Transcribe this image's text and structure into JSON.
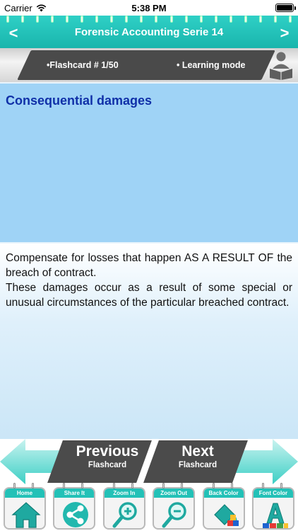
{
  "status": {
    "carrier": "Carrier",
    "time": "5:38 PM"
  },
  "nav": {
    "title": "Forensic Accounting Serie 14",
    "back": "<",
    "forward": ">"
  },
  "info": {
    "flashcard": "•Flashcard #  1/50",
    "mode": "• Learning mode"
  },
  "card": {
    "question": "Consequential damages",
    "answer": "Compensate for losses that happen AS A RESULT OF the breach of contract.\nThese damages occur as a result of some special or unusual circumstances of the particular breached contract."
  },
  "buttons": {
    "previous": {
      "big": "Previous",
      "small": "Flashcard"
    },
    "next": {
      "big": "Next",
      "small": "Flashcard"
    }
  },
  "toolbar": [
    {
      "label": "Home",
      "icon": "home-icon"
    },
    {
      "label": "Share It",
      "icon": "share-icon"
    },
    {
      "label": "Zoom In",
      "icon": "zoom-in-icon"
    },
    {
      "label": "Zoom Out",
      "icon": "zoom-out-icon"
    },
    {
      "label": "Back Color",
      "icon": "paint-bucket-icon"
    },
    {
      "label": "Font Color",
      "icon": "font-color-icon"
    }
  ],
  "colors": {
    "teal": "#23c1b7",
    "question_bg": "#9fd3f6",
    "question_text": "#1030a8",
    "dark": "#4b4b4b"
  }
}
